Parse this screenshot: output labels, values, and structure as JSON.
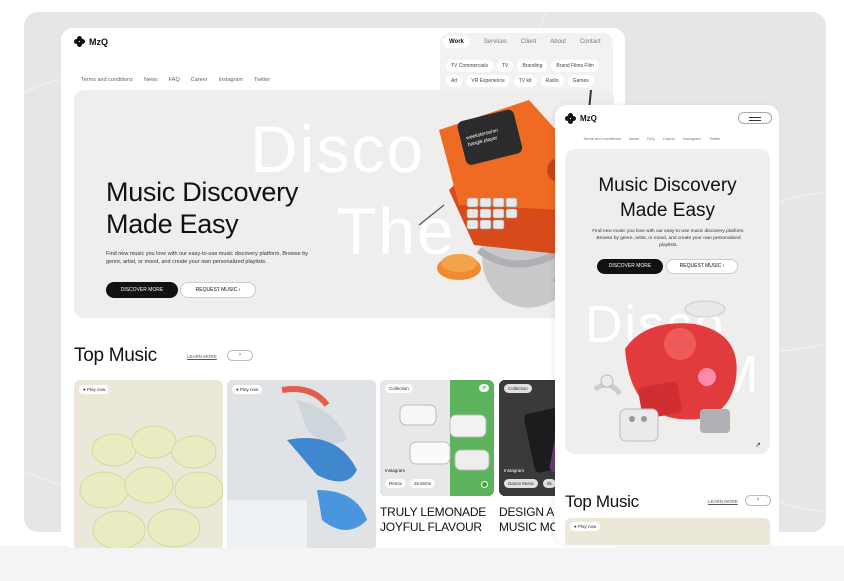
{
  "brand": "MzQ",
  "desktop": {
    "nav_primary": [
      "Work",
      "Services",
      "Client",
      "About",
      "Contact"
    ],
    "nav_tags_row1": [
      "TV Commercials",
      "TV",
      "Branding",
      "Brand Films Film"
    ],
    "nav_tags_row2": [
      "Art",
      "VR Experience",
      "TV kit",
      "Radio",
      "Games"
    ],
    "nav_secondary": [
      "Terms and conditions",
      "News",
      "FAQ",
      "Career",
      "Instagram",
      "Twitter"
    ],
    "hero": {
      "ghost_line1": "Disco",
      "ghost_line2": "The",
      "title_line1": "Music Discovery",
      "title_line2": "Made Easy",
      "description": "Find new music you love with our easy-to-use music discovery platform. Browse by genre, artist, or mood, and create your own personalized playlists.",
      "primary_cta": "DISCOVER MORE",
      "secondary_cta": "REQUEST MUSIC",
      "robot_screen_text": "weeksteroo/on\nbangle player"
    },
    "top_music": {
      "title": "Top Music",
      "learn_more": "LEARN MORE",
      "arrow": "›",
      "cards": [
        {
          "tag": "Play now"
        },
        {
          "tag": "Play now"
        },
        {
          "tag": "Collection",
          "sub_tag": "Instagram",
          "chip1": "Remix",
          "chip2": "26 items",
          "caption1": "TRULY LEMONADE",
          "caption2": "JOYFUL FLAVOUR"
        },
        {
          "tag": "Collection",
          "sub_tag": "Instagram",
          "chip1": "Dance Music",
          "chip2": "5k",
          "caption1": "DESIGN A",
          "caption2": "MUSIC MC"
        }
      ]
    }
  },
  "mobile": {
    "nav_secondary": [
      "Terms and conditions",
      "News",
      "FAQ",
      "Career",
      "Instagram",
      "Twitter"
    ],
    "hero": {
      "ghost_line1": "Disco",
      "ghost_line2": "M",
      "title_line1": "Music Discovery",
      "title_line2": "Made Easy",
      "description": "Find new music you love with our easy-to-use music discovery platform. Browse by genre, artist, or mood, and create your own personalized playlists.",
      "primary_cta": "DISCOVER MORE",
      "secondary_cta": "REQUEST MUSIC",
      "corner_arrow": "↗"
    },
    "top_music": {
      "title": "Top Music",
      "learn_more": "LEARN MORE",
      "arrow": "›",
      "first_tag": "Play now"
    }
  },
  "colors": {
    "dark": "#111111",
    "hero_bg": "#efeeec",
    "robot_orange": "#e8641c",
    "accent_red": "#e03b3b"
  }
}
